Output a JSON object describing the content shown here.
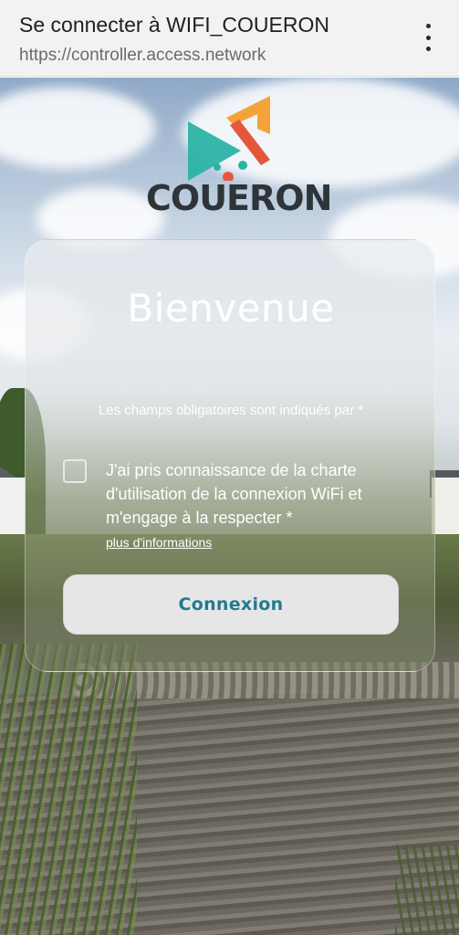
{
  "header": {
    "title": "Se connecter à WIFI_COUERON",
    "url": "https://controller.access.network",
    "menu_icon": "more-vert-icon"
  },
  "logo": {
    "wordmark": "COUERON",
    "colors": {
      "teal": "#2bb3a4",
      "orange": "#f2a33a",
      "coral": "#e4573d",
      "dark": "#2e3438"
    }
  },
  "card": {
    "welcome": "Bienvenue",
    "required_note": "Les champs obligatoires sont indiqués par *",
    "consent_text": "J'ai pris connaissance de la charte d'utilisation de la connexion WiFi et m'engage à la respecter *",
    "consent_checked": false,
    "more_info_link": "plus d'informations",
    "connect_button": "Connexion",
    "button_text_color": "#237a8f"
  }
}
